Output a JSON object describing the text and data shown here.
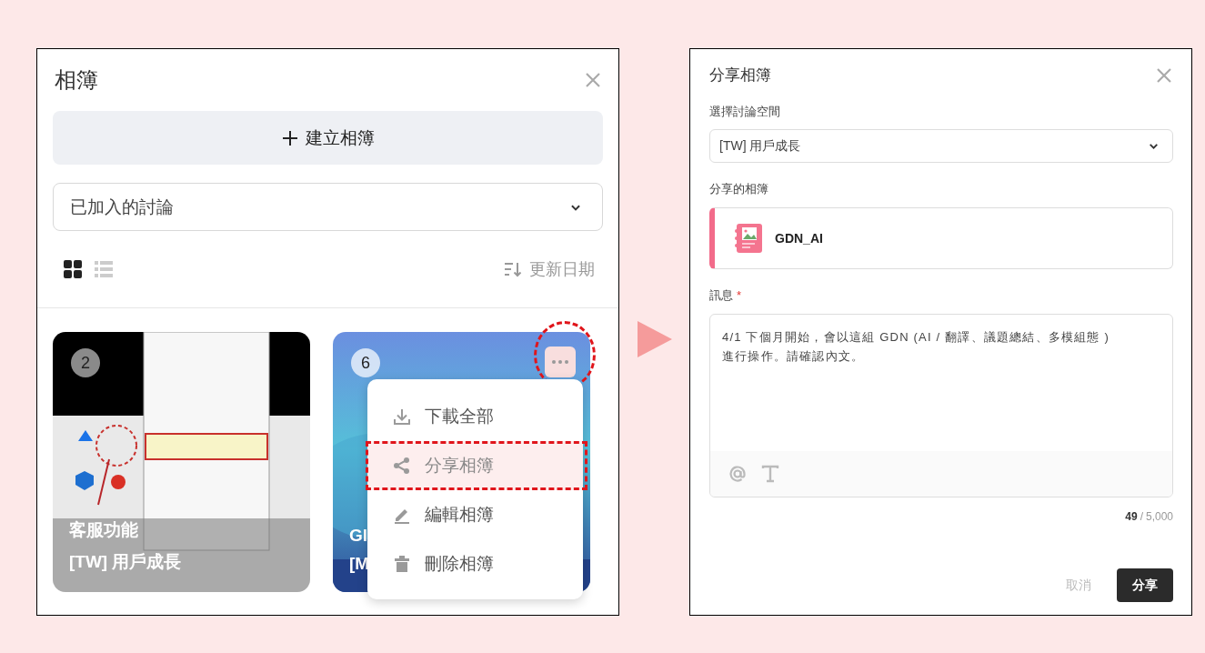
{
  "album_panel": {
    "title": "相簿",
    "create_button": "建立相簿",
    "filter": {
      "value": "已加入的討論"
    },
    "view_modes": [
      {
        "kind": "grid",
        "selected": true
      },
      {
        "kind": "list",
        "selected": false
      }
    ],
    "sort": "更新日期",
    "albums": [
      {
        "count": "2",
        "title": "客服功能",
        "subtitle": "[TW] 用戶成長",
        "menu_open": false
      },
      {
        "count": "6",
        "title": "GI",
        "subtitle": "[M",
        "menu_open": true
      }
    ],
    "menu": {
      "items": [
        {
          "kind": "download",
          "label": "下載全部",
          "selected": false
        },
        {
          "kind": "share",
          "label": "分享相簿",
          "selected": true
        },
        {
          "kind": "edit",
          "label": "編輯相簿",
          "selected": false
        },
        {
          "kind": "delete",
          "label": "刪除相簿",
          "selected": false
        }
      ]
    }
  },
  "share_dialog": {
    "title": "分享相簿",
    "space_label": "選擇討論空間",
    "space": {
      "value": "[TW] 用戶成長"
    },
    "album_label": "分享的相簿",
    "album": {
      "name": "GDN_AI"
    },
    "message_label": "訊息",
    "required_mark": "*",
    "message": {
      "value": "4/1 下個月開始，會以這組 GDN (AI / 翻譯、議題總結、多模組態 ) 進行操作。請確認內文。"
    },
    "counter": {
      "count": "49",
      "separator": "/",
      "limit": "5,000"
    },
    "buttons": [
      {
        "kind": "secondary",
        "label": "取消"
      },
      {
        "kind": "primary",
        "label": "分享"
      }
    ]
  }
}
